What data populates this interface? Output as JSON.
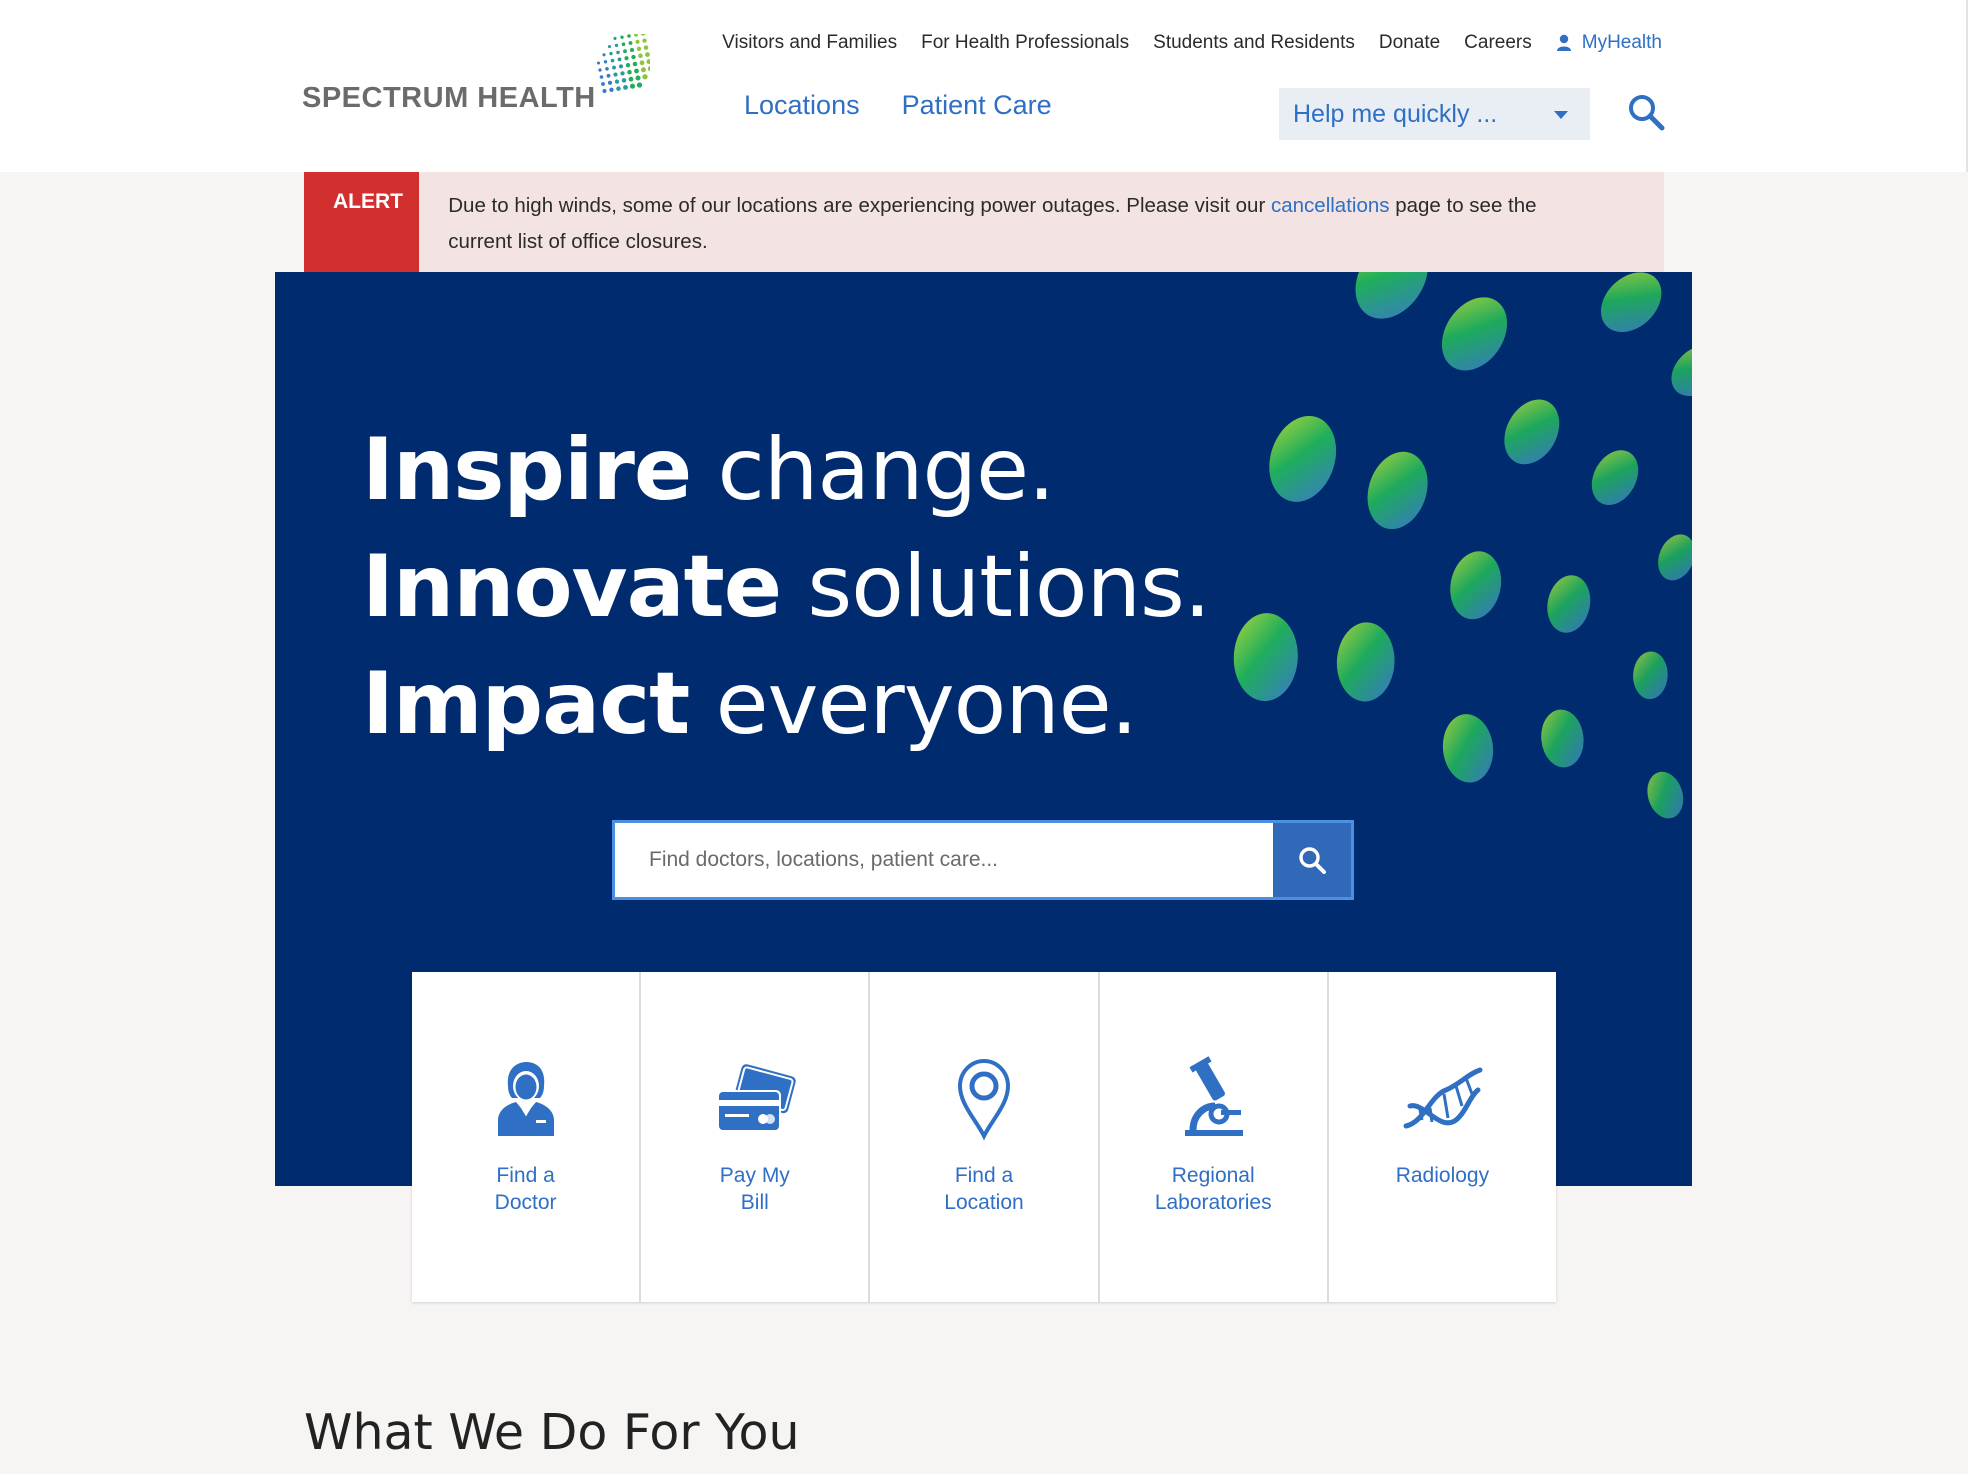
{
  "brand": {
    "name": "SPECTRUM HEALTH"
  },
  "utility_nav": [
    {
      "label": "Visitors and Families"
    },
    {
      "label": "For Health Professionals"
    },
    {
      "label": "Students and Residents"
    },
    {
      "label": "Donate"
    },
    {
      "label": "Careers"
    }
  ],
  "myhealth": {
    "label": "MyHealth",
    "icon": "user-icon"
  },
  "primary_nav": [
    {
      "label": "Locations"
    },
    {
      "label": "Patient Care"
    }
  ],
  "help_select": {
    "label": "Help me quickly ..."
  },
  "alert": {
    "tag": "ALERT",
    "text_before": "Due to high winds, some of our locations are experiencing power outages. Please visit our ",
    "link": "cancellations",
    "text_after": " page to see the current list of office closures."
  },
  "hero": {
    "lines": [
      {
        "bold": "Inspire",
        "light": " change."
      },
      {
        "bold": "Innovate",
        "light": " solutions."
      },
      {
        "bold": "Impact",
        "light": " everyone."
      }
    ],
    "search_placeholder": "Find doctors, locations, patient care..."
  },
  "quick_links": [
    {
      "label_1": "Find a",
      "label_2": "Doctor",
      "icon": "doctor-icon"
    },
    {
      "label_1": "Pay My",
      "label_2": "Bill",
      "icon": "credit-card-icon"
    },
    {
      "label_1": "Find a",
      "label_2": "Location",
      "icon": "map-pin-icon"
    },
    {
      "label_1": "Regional",
      "label_2": "Laboratories",
      "icon": "microscope-icon"
    },
    {
      "label_1": "Radiology",
      "label_2": "",
      "icon": "dna-icon"
    }
  ],
  "section": {
    "title": "What We Do For You"
  },
  "colors": {
    "brand_blue": "#2f6fc4",
    "hero_navy": "#002b6e",
    "alert_red": "#d1302e",
    "alert_bg": "#f3e4e3"
  }
}
